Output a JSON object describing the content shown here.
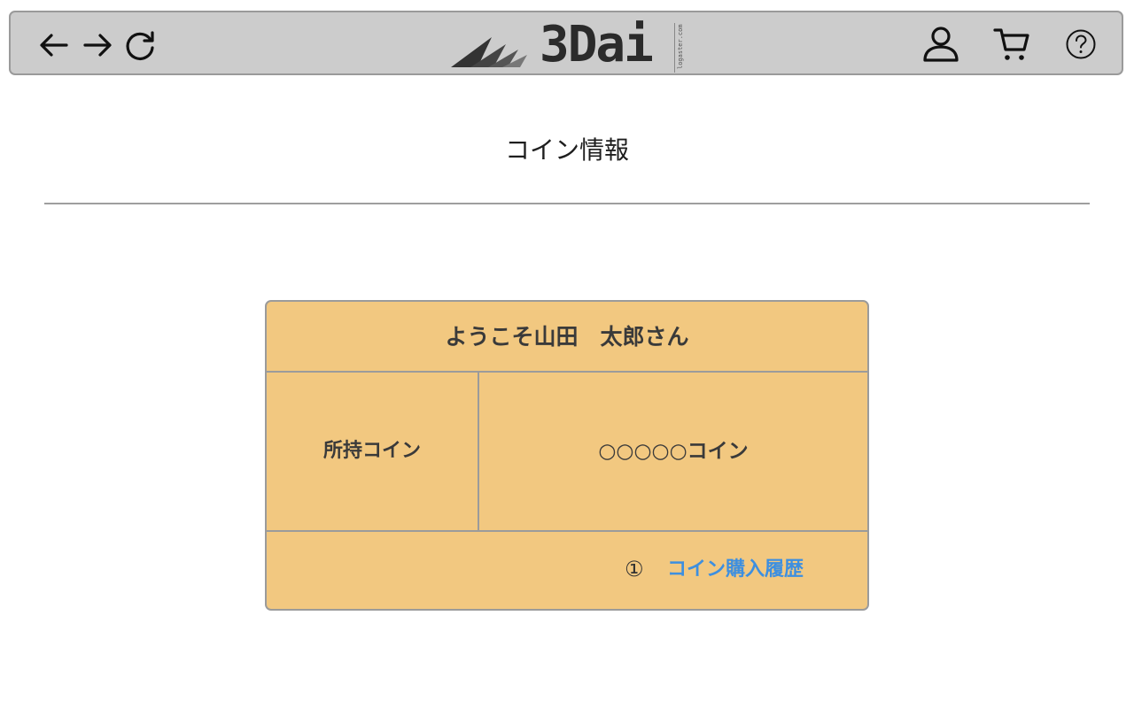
{
  "header": {
    "logo": {
      "mark": "3Dai",
      "sub": "logaster.com"
    },
    "icons": {
      "back": "arrow-left-icon",
      "forward": "arrow-right-icon",
      "reload": "reload-icon",
      "user": "user-icon",
      "cart": "cart-icon",
      "help": "help-icon"
    },
    "colors": {
      "bar_bg": "#cccccc",
      "bar_border": "#9a9a9a"
    }
  },
  "page": {
    "title": "コイン情報"
  },
  "coin_card": {
    "welcome": "ようこそ山田　太郎さん",
    "owned_label": "所持コイン",
    "owned_value": "○○○○○コイン",
    "history_number": "①",
    "history_link": "コイン購入履歴",
    "colors": {
      "card_bg": "#f2c880",
      "link": "#3d8fe0"
    }
  }
}
